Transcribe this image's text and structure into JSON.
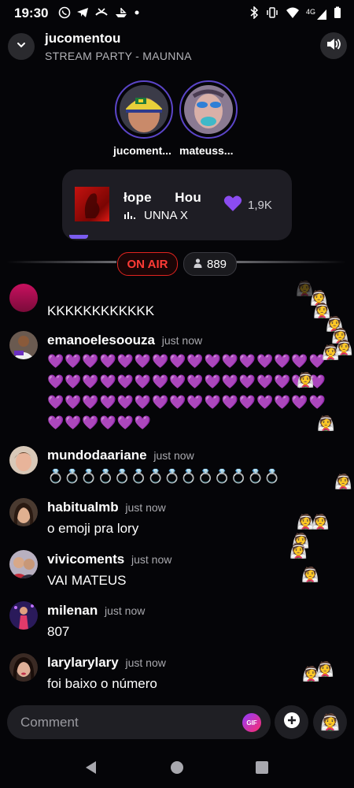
{
  "status_bar": {
    "time": "19:30",
    "left_icons": [
      "whatsapp-icon",
      "telegram-icon",
      "missed-call-icon",
      "boat-icon",
      "dot-icon"
    ],
    "right_icons": [
      "bluetooth-icon",
      "vibrate-icon",
      "wifi-icon",
      "signal-4g-icon",
      "battery-icon"
    ],
    "network": "4G"
  },
  "header": {
    "host_name": "jucomentou",
    "stream_title": "STREAM PARTY - MAUNNA"
  },
  "hosts": [
    {
      "label": "jucoment..."
    },
    {
      "label": "mateuss..."
    }
  ],
  "music": {
    "title": "łope      Hou",
    "artist": "UNNA X",
    "likes": "1,9K"
  },
  "live": {
    "on_air_label": "ON AIR",
    "viewers": "889"
  },
  "comments": [
    {
      "user": "",
      "time": "",
      "text": "KKKKKKKKKKKK"
    },
    {
      "user": "emanoelesoouza",
      "time": "just now",
      "text": "💜💜💜💜💜💜💜💜💜💜💜💜💜💜💜💜💜💜💜💜💜💜💜💜💜💜💜💜💜💜💜💜💜💜💜💜💜💜💜💜💜💜💜💜💜💜💜💜💜💜💜💜💜💜"
    },
    {
      "user": "mundodaariane",
      "time": "just now",
      "text": "💍💍💍💍💍💍💍💍💍💍💍💍💍💍"
    },
    {
      "user": "habitualmb",
      "time": "just now",
      "text": "o emoji pra lory"
    },
    {
      "user": "vivicoments",
      "time": "just now",
      "text": "VAI MATEUS"
    },
    {
      "user": "milenan",
      "time": "just now",
      "text": "807"
    },
    {
      "user": "larylarylary",
      "time": "just now",
      "text": "foi baixo o número"
    }
  ],
  "input": {
    "placeholder": "Comment",
    "gif_label": "GIF"
  },
  "floating_emoji": "👰",
  "nav_icons": [
    "back-icon",
    "home-icon",
    "recents-icon"
  ],
  "colors": {
    "background": "#050508",
    "accent": "#7b5cf0",
    "on_air": "#e0231f",
    "heart": "#8b4cf0"
  }
}
